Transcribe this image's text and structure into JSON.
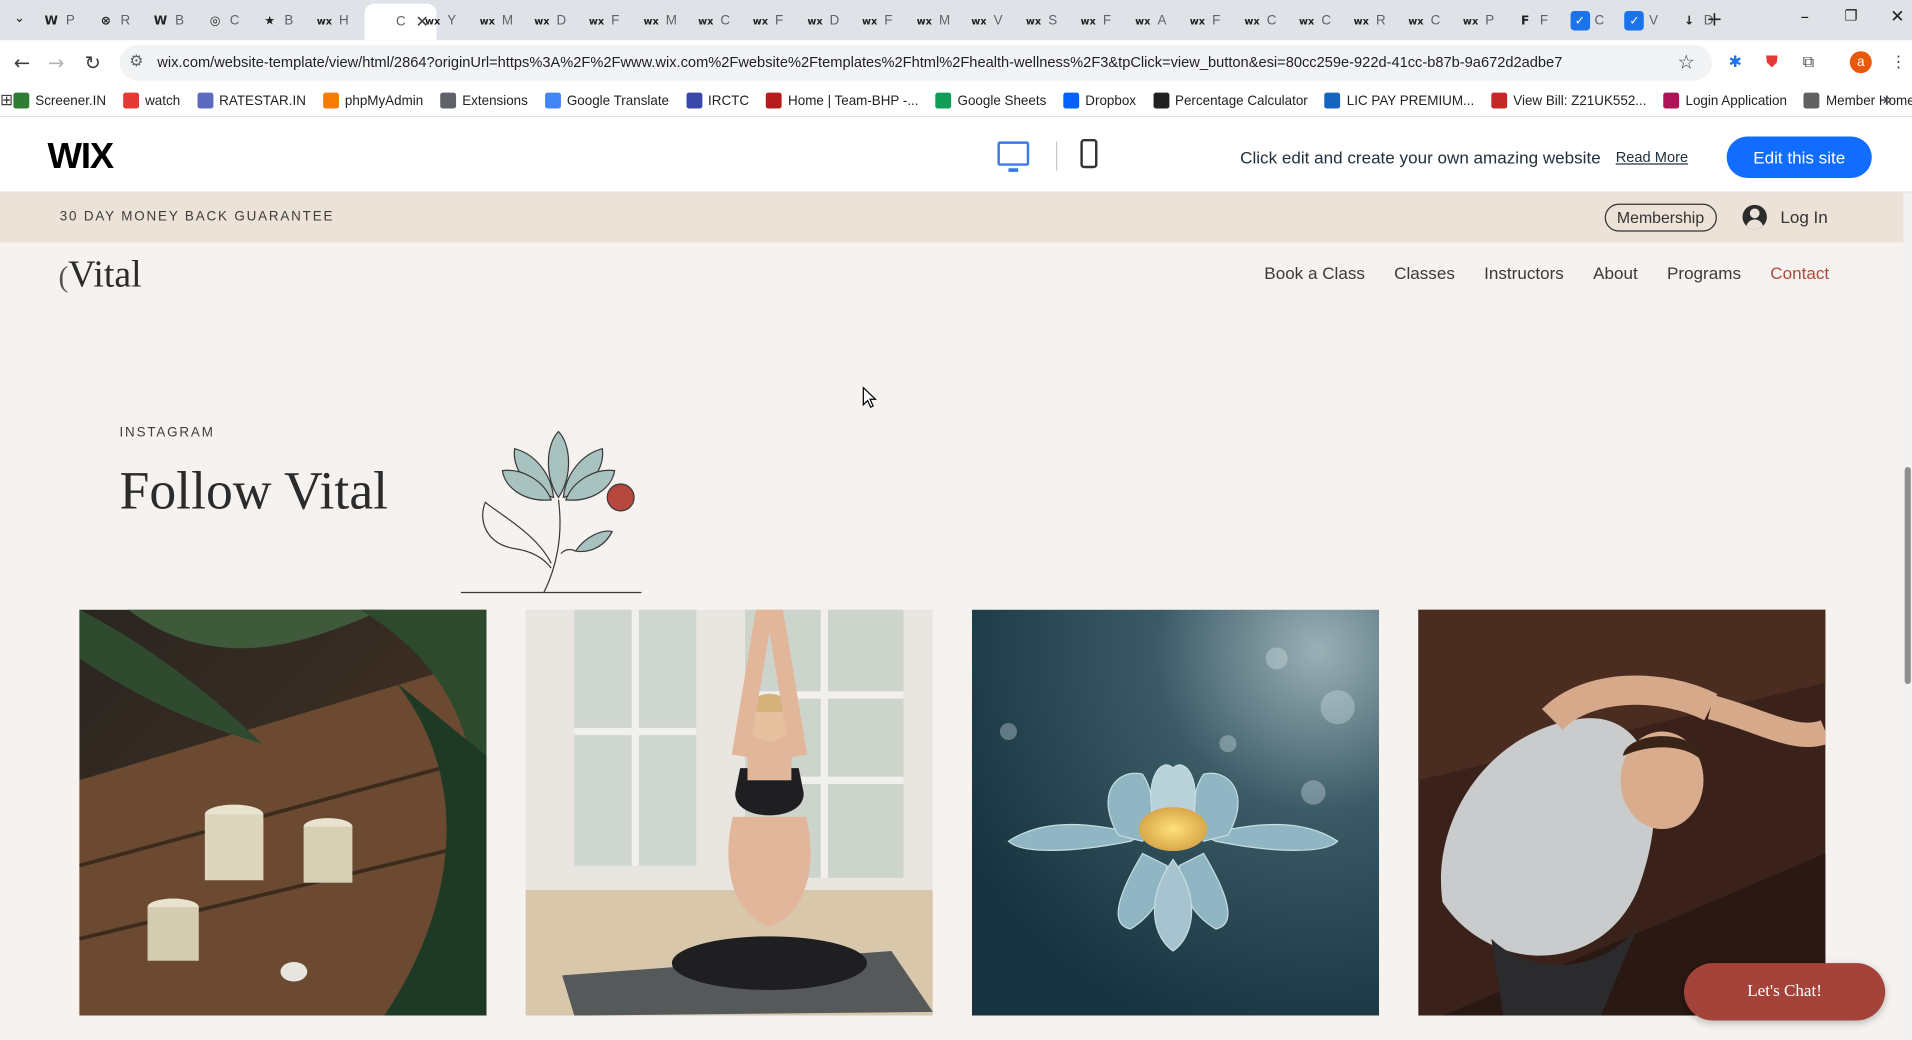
{
  "browser": {
    "tabs": [
      {
        "icon": "W",
        "letter": "P",
        "color": "#dfe3e7"
      },
      {
        "icon": "⊗",
        "letter": "R",
        "color": "#dfe3e7"
      },
      {
        "icon": "W",
        "letter": "B",
        "color": "#dfe3e7"
      },
      {
        "icon": "◎",
        "letter": "C",
        "color": "#dfe3e7"
      },
      {
        "icon": "★",
        "letter": "B",
        "color": "#dfe3e7"
      },
      {
        "icon": "wx",
        "letter": "H",
        "color": "#dfe3e7"
      },
      {
        "icon": "",
        "letter": "C",
        "color": "#ffffff",
        "active": true
      },
      {
        "icon": "wx",
        "letter": "Y",
        "color": "#dfe3e7"
      },
      {
        "icon": "wx",
        "letter": "M",
        "color": "#dfe3e7"
      },
      {
        "icon": "wx",
        "letter": "D",
        "color": "#dfe3e7"
      },
      {
        "icon": "wx",
        "letter": "F",
        "color": "#dfe3e7"
      },
      {
        "icon": "wx",
        "letter": "M",
        "color": "#dfe3e7"
      },
      {
        "icon": "wx",
        "letter": "C",
        "color": "#dfe3e7"
      },
      {
        "icon": "wx",
        "letter": "F",
        "color": "#dfe3e7"
      },
      {
        "icon": "wx",
        "letter": "D",
        "color": "#dfe3e7"
      },
      {
        "icon": "wx",
        "letter": "F",
        "color": "#dfe3e7"
      },
      {
        "icon": "wx",
        "letter": "M",
        "color": "#dfe3e7"
      },
      {
        "icon": "wx",
        "letter": "V",
        "color": "#dfe3e7"
      },
      {
        "icon": "wx",
        "letter": "S",
        "color": "#dfe3e7"
      },
      {
        "icon": "wx",
        "letter": "F",
        "color": "#dfe3e7"
      },
      {
        "icon": "wx",
        "letter": "A",
        "color": "#dfe3e7"
      },
      {
        "icon": "wx",
        "letter": "F",
        "color": "#dfe3e7"
      },
      {
        "icon": "wx",
        "letter": "C",
        "color": "#dfe3e7"
      },
      {
        "icon": "wx",
        "letter": "C",
        "color": "#dfe3e7"
      },
      {
        "icon": "wx",
        "letter": "R",
        "color": "#dfe3e7"
      },
      {
        "icon": "wx",
        "letter": "C",
        "color": "#dfe3e7"
      },
      {
        "icon": "wx",
        "letter": "P",
        "color": "#dfe3e7"
      },
      {
        "icon": "F",
        "letter": "F",
        "color": "#dfe3e7"
      },
      {
        "icon": "✓",
        "letter": "C",
        "color": "#dfe3e7"
      },
      {
        "icon": "✓",
        "letter": "V",
        "color": "#dfe3e7"
      },
      {
        "icon": "↓",
        "letter": "D",
        "color": "#dfe3e7"
      }
    ],
    "new_tab": "+",
    "url": "wix.com/website-template/view/html/2864?originUrl=https%3A%2F%2Fwww.wix.com%2Fwebsite%2Ftemplates%2Fhtml%2Fhealth-wellness%2F3&tpClick=view_button&esi=80cc259e-922d-41cc-b87b-9a672d2adbe7",
    "profile_initial": "a",
    "bookmarks": [
      {
        "label": "Screener.IN",
        "color": "#2e7d32"
      },
      {
        "label": "watch",
        "color": "#e53935"
      },
      {
        "label": "RATESTAR.IN",
        "color": "#5c6bc0"
      },
      {
        "label": "phpMyAdmin",
        "color": "#f57c00"
      },
      {
        "label": "Extensions",
        "color": "#5f6368"
      },
      {
        "label": "Google Translate",
        "color": "#4285f4"
      },
      {
        "label": "IRCTC",
        "color": "#3949ab"
      },
      {
        "label": "Home | Team-BHP -...",
        "color": "#b71c1c"
      },
      {
        "label": "Google Sheets",
        "color": "#0f9d58"
      },
      {
        "label": "Dropbox",
        "color": "#0061ff"
      },
      {
        "label": "Percentage Calculator",
        "color": "#212121"
      },
      {
        "label": "LIC PAY PREMIUM...",
        "color": "#1565c0"
      },
      {
        "label": "View Bill: Z21UK552...",
        "color": "#c62828"
      },
      {
        "label": "Login Application",
        "color": "#ad1457"
      },
      {
        "label": "Member Home",
        "color": "#616161"
      }
    ]
  },
  "wix_bar": {
    "logo": "WIX",
    "tagline": "Click edit and create your own amazing website",
    "read_more": "Read More",
    "edit_button": "Edit this site",
    "accent": "#116dff"
  },
  "site": {
    "announcement": "30 DAY MONEY BACK GUARANTEE",
    "membership": "Membership",
    "login": "Log In",
    "logo": "Vital",
    "nav": [
      "Book a Class",
      "Classes",
      "Instructors",
      "About",
      "Programs",
      "Contact"
    ],
    "nav_active_index": 5,
    "instagram_label": "INSTAGRAM",
    "instagram_title": "Follow Vital",
    "photos": [
      "candles-plant-photo",
      "woman-meditating-photo",
      "lotus-flower-photo",
      "woman-yoga-stretch-photo"
    ],
    "chat_button": "Let's Chat!",
    "colors": {
      "background": "#f5f2ef",
      "banner": "#ece2d7",
      "accent": "#a4433a"
    }
  }
}
